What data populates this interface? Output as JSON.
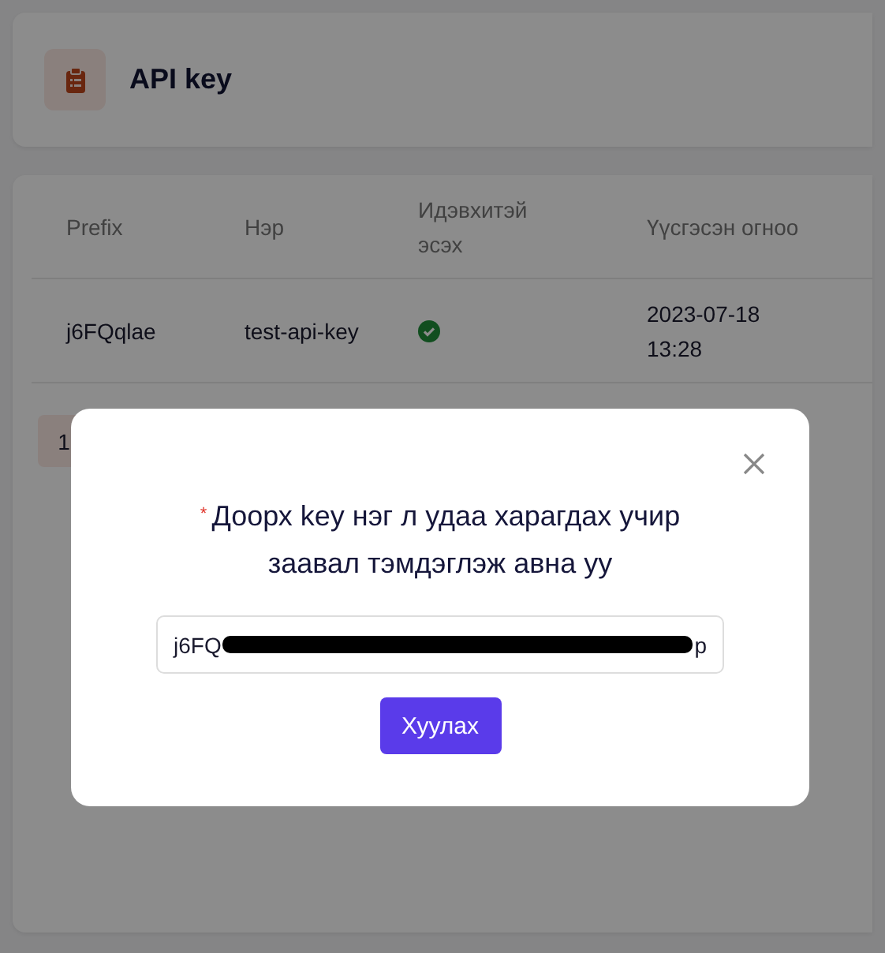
{
  "header": {
    "title": "API key"
  },
  "table": {
    "columns": [
      "Prefix",
      "Нэр",
      "Идэвхитэй эсэх",
      "Үүсгэсэн огноо"
    ],
    "rows": [
      {
        "prefix": "j6FQqlae",
        "name": "test-api-key",
        "active": true,
        "created": "2023-07-18 13:28"
      }
    ]
  },
  "pagination": {
    "pages": [
      {
        "label": "1",
        "selected": true
      }
    ]
  },
  "modal": {
    "message": "Доорх key нэг л удаа харагдах учир заавал тэмдэглэж авна уу",
    "required_mark": "*",
    "field": {
      "value_start": "j6FQ",
      "value_end": "p",
      "redacted": true
    },
    "button": "Хуулах"
  }
}
